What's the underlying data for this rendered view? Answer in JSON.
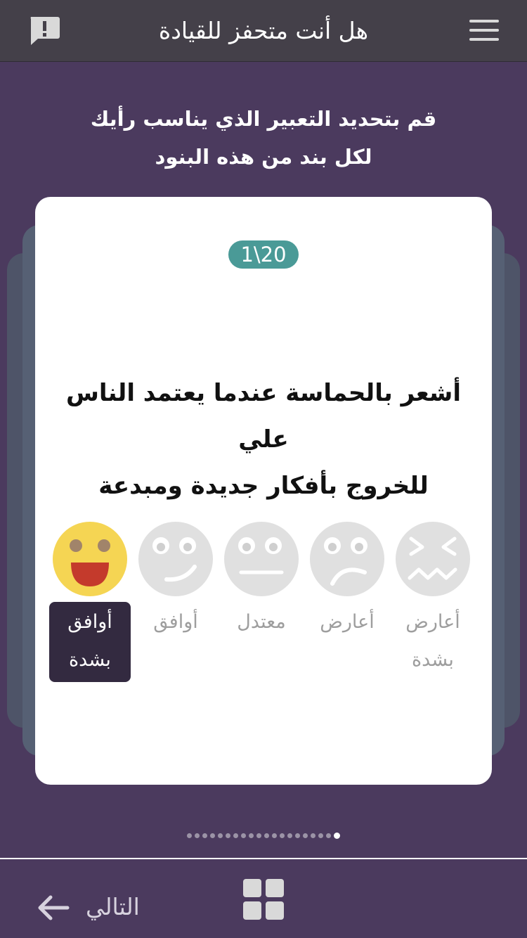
{
  "header": {
    "title": "هل أنت متحفز للقيادة",
    "report_icon": "report-icon",
    "menu_icon": "hamburger-menu-icon"
  },
  "instructions": {
    "line1": "قم بتحديد التعبير الذي يناسب رأيك",
    "line2": "لكل بند من هذه البنود"
  },
  "card": {
    "counter": "1\\20",
    "question_line1": "أشعر بالحماسة عندما يعتمد الناس علي",
    "question_line2": "للخروج بأفكار جديدة ومبدعة"
  },
  "options": [
    {
      "label_line1": "أوافق",
      "label_line2": "بشدة",
      "icon": "laughing-face-icon",
      "selected": true
    },
    {
      "label_line1": "أوافق",
      "label_line2": "",
      "icon": "smiling-face-icon",
      "selected": false
    },
    {
      "label_line1": "معتدل",
      "label_line2": "",
      "icon": "neutral-face-icon",
      "selected": false
    },
    {
      "label_line1": "أعارض",
      "label_line2": "",
      "icon": "sad-face-icon",
      "selected": false
    },
    {
      "label_line1": "أعارض",
      "label_line2": "بشدة",
      "icon": "confounded-face-icon",
      "selected": false
    }
  ],
  "pagination": {
    "total": 20,
    "current": 1
  },
  "footer": {
    "next_label": "التالي",
    "next_icon": "arrow-left-icon",
    "grid_icon": "grid-icon"
  },
  "colors": {
    "background": "#4b3a5e",
    "topbar": "#444049",
    "accent_teal": "#4a9a97",
    "selected_face": "#f5d553",
    "selected_label_bg": "#332a40",
    "inactive_face": "#e0e0e0"
  }
}
